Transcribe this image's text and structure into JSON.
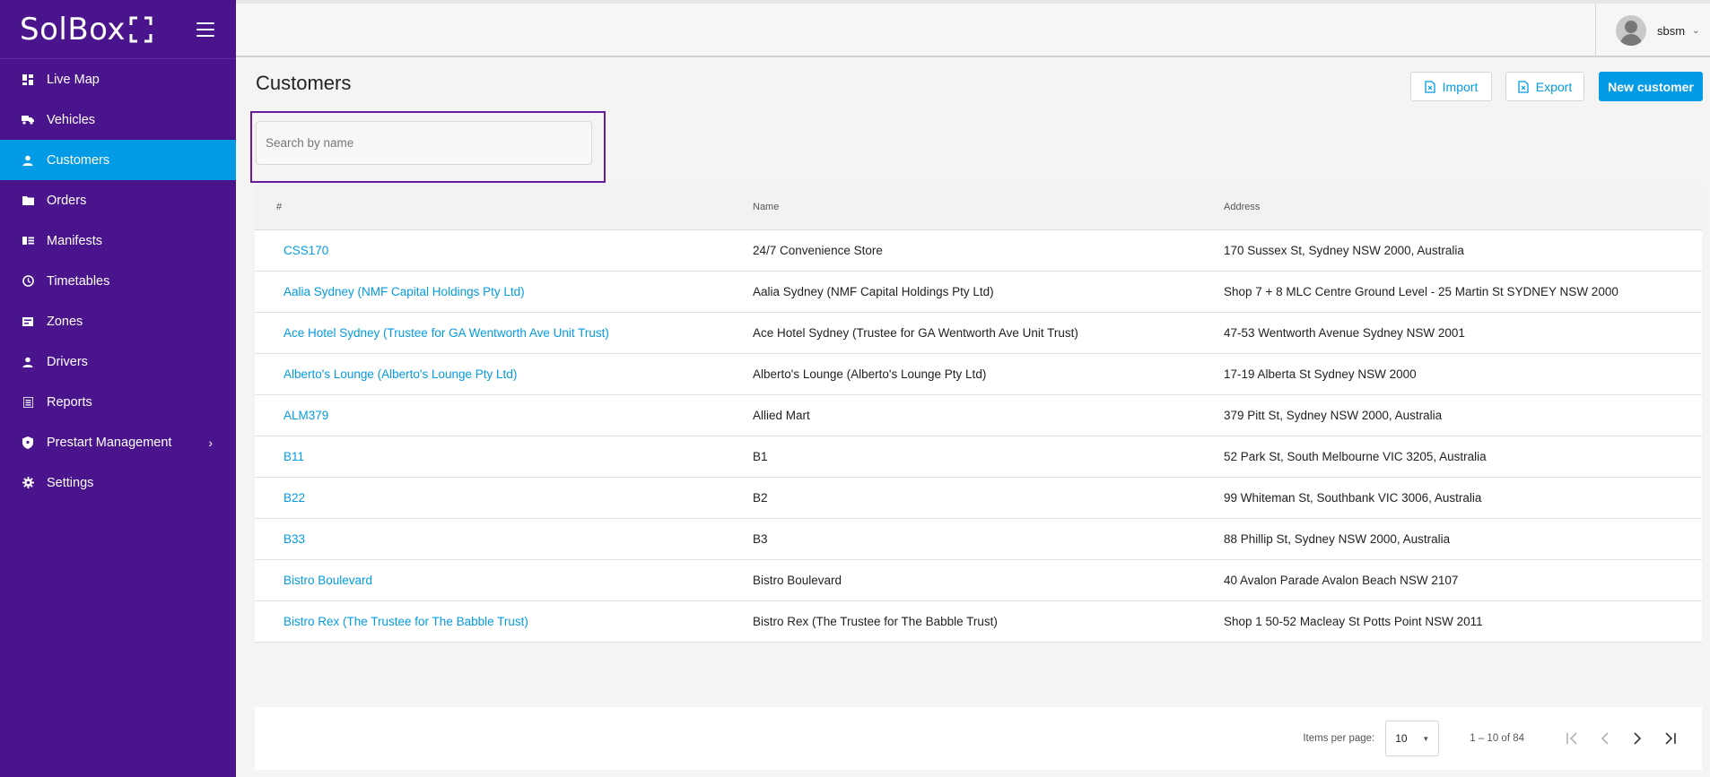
{
  "app": {
    "brand": "SolBox"
  },
  "user": {
    "name": "sbsm"
  },
  "sidebar": {
    "items": [
      {
        "label": "Live Map",
        "icon": "dashboard-icon"
      },
      {
        "label": "Vehicles",
        "icon": "truck-icon"
      },
      {
        "label": "Customers",
        "icon": "person-icon",
        "active": true
      },
      {
        "label": "Orders",
        "icon": "folder-icon"
      },
      {
        "label": "Manifests",
        "icon": "manifest-icon"
      },
      {
        "label": "Timetables",
        "icon": "clock-icon"
      },
      {
        "label": "Zones",
        "icon": "zones-icon"
      },
      {
        "label": "Drivers",
        "icon": "person-icon"
      },
      {
        "label": "Reports",
        "icon": "report-icon"
      },
      {
        "label": "Prestart Management",
        "icon": "shield-icon",
        "has_submenu": true
      },
      {
        "label": "Settings",
        "icon": "gear-icon"
      }
    ]
  },
  "page": {
    "title": "Customers",
    "import_label": "Import",
    "export_label": "Export",
    "new_label": "New customer"
  },
  "search": {
    "placeholder": "Search by name",
    "value": ""
  },
  "table": {
    "headers": [
      "#",
      "Name",
      "Address"
    ],
    "rows": [
      {
        "id": "CSS170",
        "name": "24/7 Convenience Store",
        "address": "170 Sussex St, Sydney NSW 2000, Australia"
      },
      {
        "id": "Aalia Sydney (NMF Capital Holdings Pty Ltd)",
        "name": "Aalia Sydney (NMF Capital Holdings Pty Ltd)",
        "address": "Shop 7 + 8 MLC Centre Ground Level - 25 Martin St SYDNEY NSW 2000"
      },
      {
        "id": "Ace Hotel Sydney (Trustee for GA Wentworth Ave Unit Trust)",
        "name": "Ace Hotel Sydney (Trustee for GA Wentworth Ave Unit Trust)",
        "address": "47-53 Wentworth Avenue Sydney NSW 2001"
      },
      {
        "id": "Alberto's Lounge (Alberto's Lounge Pty Ltd)",
        "name": "Alberto's Lounge (Alberto's Lounge Pty Ltd)",
        "address": "17-19 Alberta St Sydney NSW 2000"
      },
      {
        "id": "ALM379",
        "name": "Allied Mart",
        "address": "379 Pitt St, Sydney NSW 2000, Australia"
      },
      {
        "id": "B11",
        "name": "B1",
        "address": "52 Park St, South Melbourne VIC 3205, Australia"
      },
      {
        "id": "B22",
        "name": "B2",
        "address": "99 Whiteman St, Southbank VIC 3006, Australia"
      },
      {
        "id": "B33",
        "name": "B3",
        "address": "88 Phillip St, Sydney NSW 2000, Australia"
      },
      {
        "id": "Bistro Boulevard",
        "name": "Bistro Boulevard",
        "address": "40 Avalon Parade Avalon Beach NSW 2107"
      },
      {
        "id": "Bistro Rex (The Trustee for The Babble Trust)",
        "name": "Bistro Rex (The Trustee for The Babble Trust)",
        "address": "Shop 1 50-52 Macleay St Potts Point NSW 2011"
      }
    ]
  },
  "pagination": {
    "items_per_page_label": "Items per page:",
    "items_per_page": "10",
    "range_label": "1 – 10 of 84"
  },
  "colors": {
    "sidebar_bg": "#4a148c",
    "accent": "#039be5",
    "highlight_border": "#6a1b9a"
  }
}
